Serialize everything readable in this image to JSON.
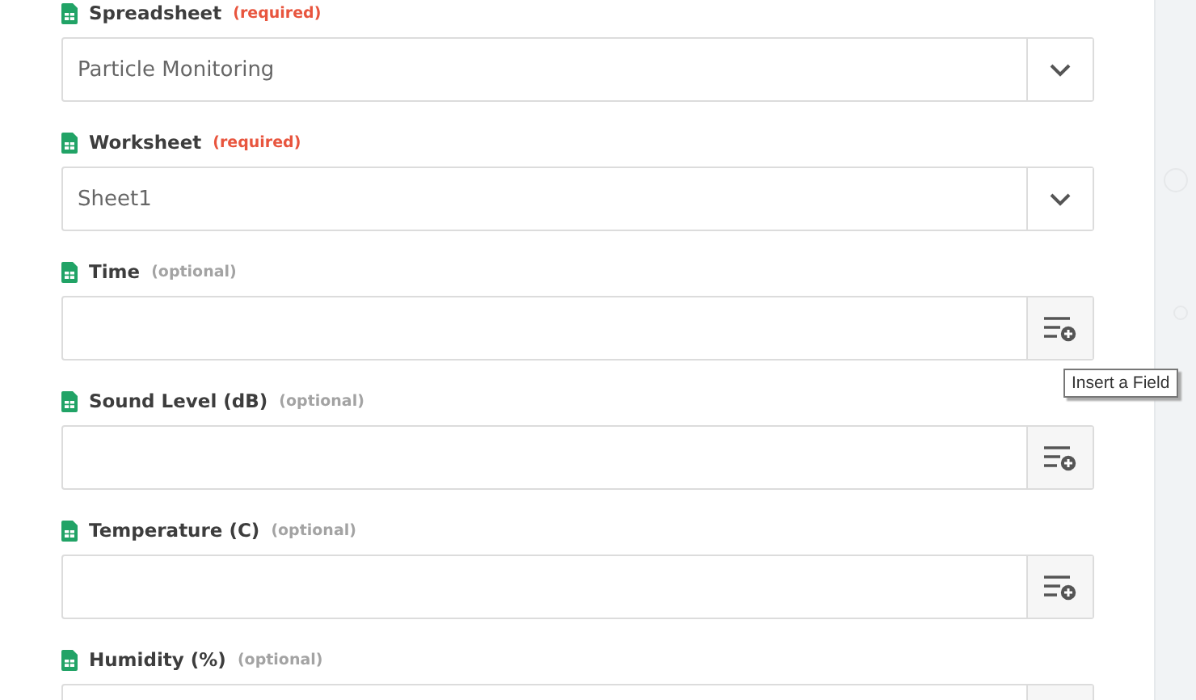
{
  "fields": [
    {
      "label": "Spreadsheet",
      "qualifier": "(required)",
      "required": true,
      "kind": "select",
      "value": "Particle Monitoring"
    },
    {
      "label": "Worksheet",
      "qualifier": "(required)",
      "required": true,
      "kind": "select",
      "value": "Sheet1"
    },
    {
      "label": "Time",
      "qualifier": "(optional)",
      "required": false,
      "kind": "text",
      "tooltip": "Insert a Field"
    },
    {
      "label": "Sound Level (dB)",
      "qualifier": "(optional)",
      "required": false,
      "kind": "text"
    },
    {
      "label": "Temperature (C)",
      "qualifier": "(optional)",
      "required": false,
      "kind": "text"
    },
    {
      "label": "Humidity (%)",
      "qualifier": "(optional)",
      "required": false,
      "kind": "text"
    }
  ]
}
